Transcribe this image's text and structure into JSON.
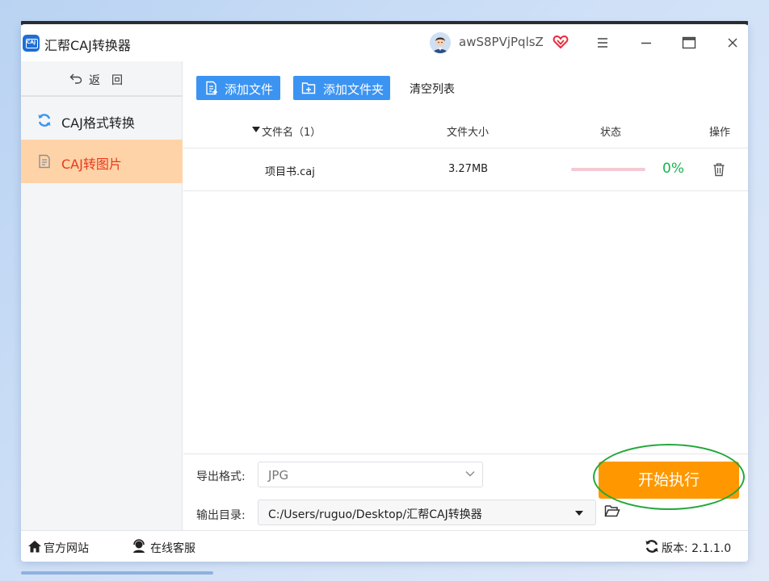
{
  "app": {
    "title": "汇帮CAJ转换器",
    "logo_text": "CAJ",
    "username": "awS8PVjPqlsZ"
  },
  "sidebar": {
    "back_label": "返回",
    "items": [
      {
        "label": "CAJ格式转换",
        "icon": "refresh-icon",
        "active": false
      },
      {
        "label": "CAJ转图片",
        "icon": "document-icon",
        "active": true
      }
    ]
  },
  "toolbar": {
    "add_file": "添加文件",
    "add_folder": "添加文件夹",
    "clear_list": "清空列表"
  },
  "table": {
    "headers": {
      "name": "文件名（1）",
      "size": "文件大小",
      "status": "状态",
      "action": "操作"
    },
    "rows": [
      {
        "name": "项目书.caj",
        "size": "3.27MB",
        "progress": 0,
        "percent_text": "0%"
      }
    ]
  },
  "controls": {
    "format_label": "导出格式:",
    "format_value": "JPG",
    "dir_label": "输出目录:",
    "dir_value": "C:/Users/ruguo/Desktop/汇帮CAJ转换器",
    "start_label": "开始执行"
  },
  "statusbar": {
    "website": "官方网站",
    "support": "在线客服",
    "version": "版本:  2.1.1.0"
  },
  "colors": {
    "accent_blue": "#3b94f2",
    "active_nav_bg": "#ffd3a8",
    "active_nav_text": "#e8391a",
    "start_button": "#ff9800",
    "progress_percent": "#19b34d",
    "highlight_ring": "#22a83a"
  }
}
